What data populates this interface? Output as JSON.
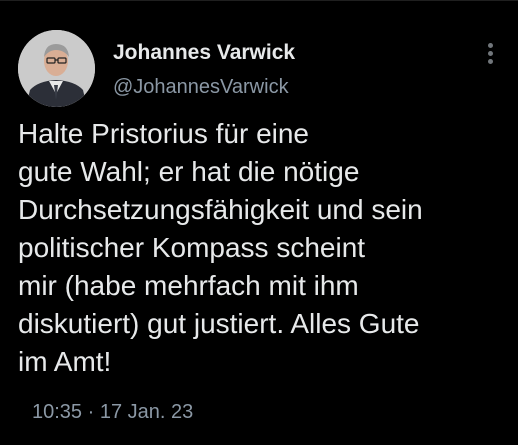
{
  "tweet": {
    "author": {
      "name": "Johannes Varwick",
      "handle": "@JohannesVarwick",
      "avatar_icon": "profile-photo"
    },
    "more_icon": "more-vertical-icon",
    "text_lines": [
      "Halte Pristorius für eine",
      "gute Wahl; er hat die nötige",
      "Durchsetzungsfähigkeit und sein",
      "politischer Kompass scheint",
      "mir (habe mehrfach mit ihm",
      "diskutiert) gut justiert. Alles Gute",
      "im Amt!"
    ],
    "timestamp": "10:35 · 17 Jan. 23"
  },
  "colors": {
    "background": "#000000",
    "primary_text": "#e7e9ea",
    "secondary_text": "#8b98a5"
  }
}
